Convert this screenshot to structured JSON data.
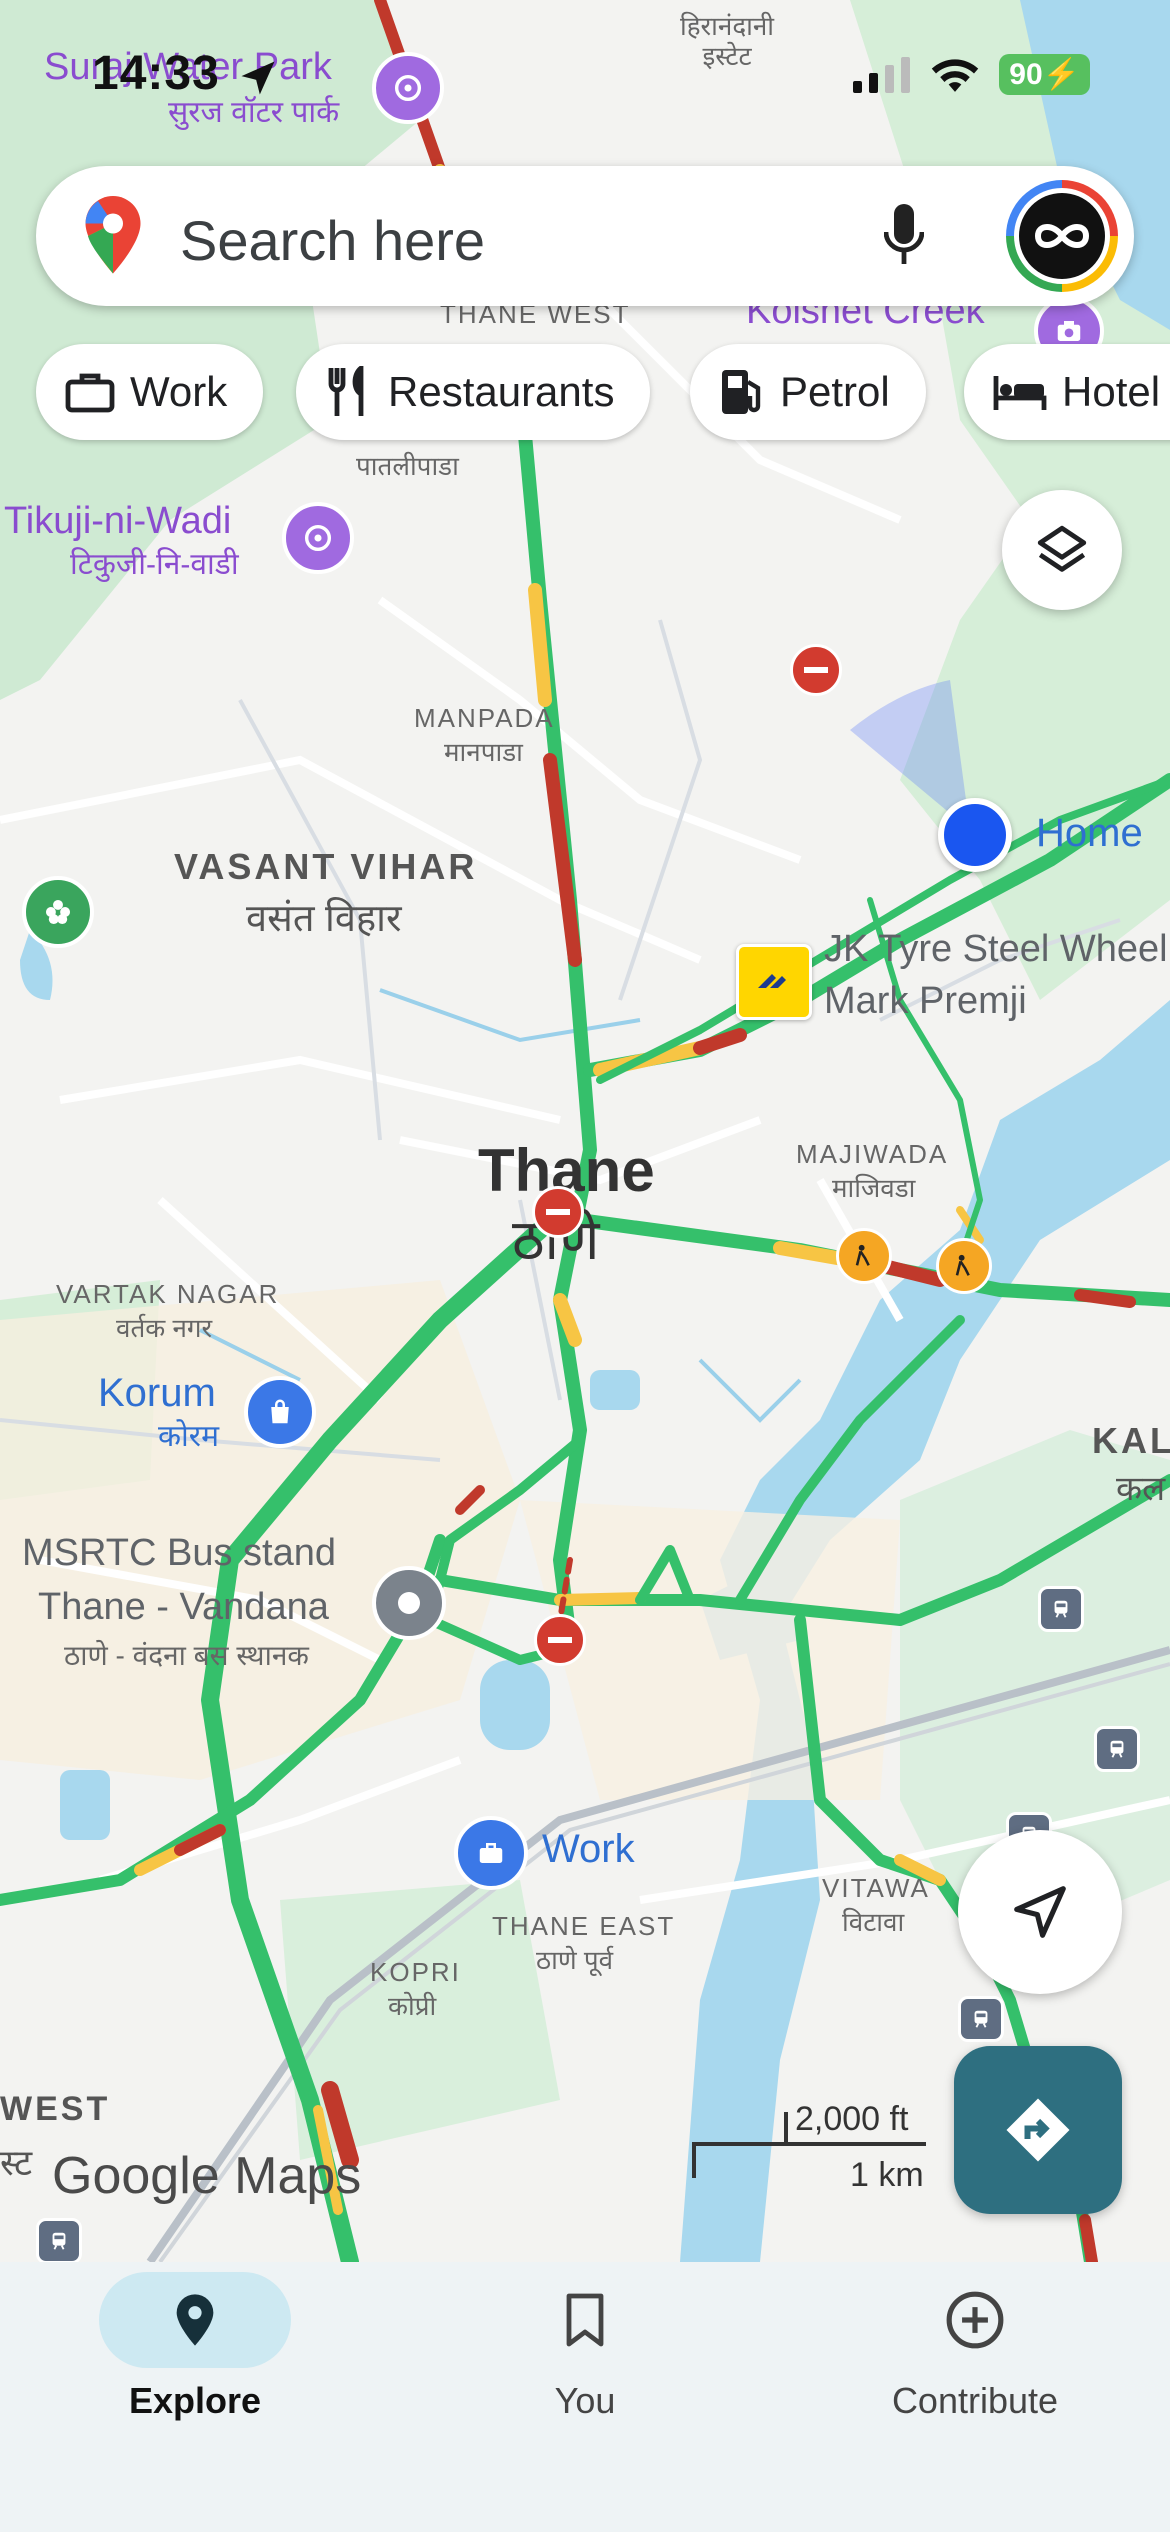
{
  "status": {
    "time": "14:33",
    "battery": "90"
  },
  "search": {
    "placeholder": "Search here"
  },
  "chips": [
    {
      "label": "Work",
      "icon": "briefcase-icon"
    },
    {
      "label": "Restaurants",
      "icon": "fork-knife-icon"
    },
    {
      "label": "Petrol",
      "icon": "fuel-icon"
    },
    {
      "label": "Hotel",
      "icon": "bed-icon"
    }
  ],
  "map": {
    "places": {
      "suraj_en": "Suraj Water Park",
      "suraj_hi": "सुरज वॉटर पार्क",
      "hiranandani_hi": "हिरानंदानी\nइस्टेट",
      "thane_west_en": "THANE WEST",
      "kolshet_en": "Kolshet Creek",
      "pataliphada_hi": "पातलीपाडा",
      "tikuji_en": "Tikuji-ni-Wadi",
      "tikuji_hi": "टिकुजी-नि-वाडी",
      "manpada_en": "MANPADA",
      "manpada_hi": "मानपाडा",
      "vasant_en": "VASANT VIHAR",
      "vasant_hi": "वसंत विहार",
      "home": "Home",
      "jk_tyre_1": "JK Tyre Steel Wheel",
      "jk_tyre_2": "Mark Premji",
      "thane_en": "Thane",
      "thane_hi": "ठाणे",
      "majiwada_en": "MAJIWADA",
      "majiwada_hi": "माजिवडा",
      "vartak_en": "VARTAK NAGAR",
      "vartak_hi": "वर्तक नगर",
      "korum_en": "Korum",
      "korum_hi": "कोरम",
      "kal_en": "KAL",
      "kal_hi": "कल",
      "msrtc_1": "MSRTC Bus stand",
      "msrtc_2": "Thane - Vandana",
      "msrtc_hi": "ठाणे - वंदना बस स्थानक",
      "work": "Work",
      "thane_east_en": "THANE EAST",
      "thane_east_hi": "ठाणे पूर्व",
      "kopri_en": "KOPRI",
      "kopri_hi": "कोप्री",
      "vitawa_en": "VITAWA",
      "vitawa_hi": "विटावा",
      "west_en": "WEST",
      "west_hi": "स्ट"
    },
    "scale": {
      "ft": "2,000 ft",
      "km": "1 km"
    },
    "logo": "Google Maps"
  },
  "nav": [
    {
      "label": "Explore",
      "icon": "location-pin-icon",
      "active": true
    },
    {
      "label": "You",
      "icon": "bookmark-icon",
      "active": false
    },
    {
      "label": "Contribute",
      "icon": "add-circle-icon",
      "active": false
    }
  ],
  "colors": {
    "traffic_green": "#35c06b",
    "traffic_yellow": "#f7c544",
    "traffic_red": "#c0392b",
    "water": "#a8d8ee",
    "park": "#cfead3",
    "accent_blue": "#1a56f0",
    "directions": "#2e6f80"
  }
}
